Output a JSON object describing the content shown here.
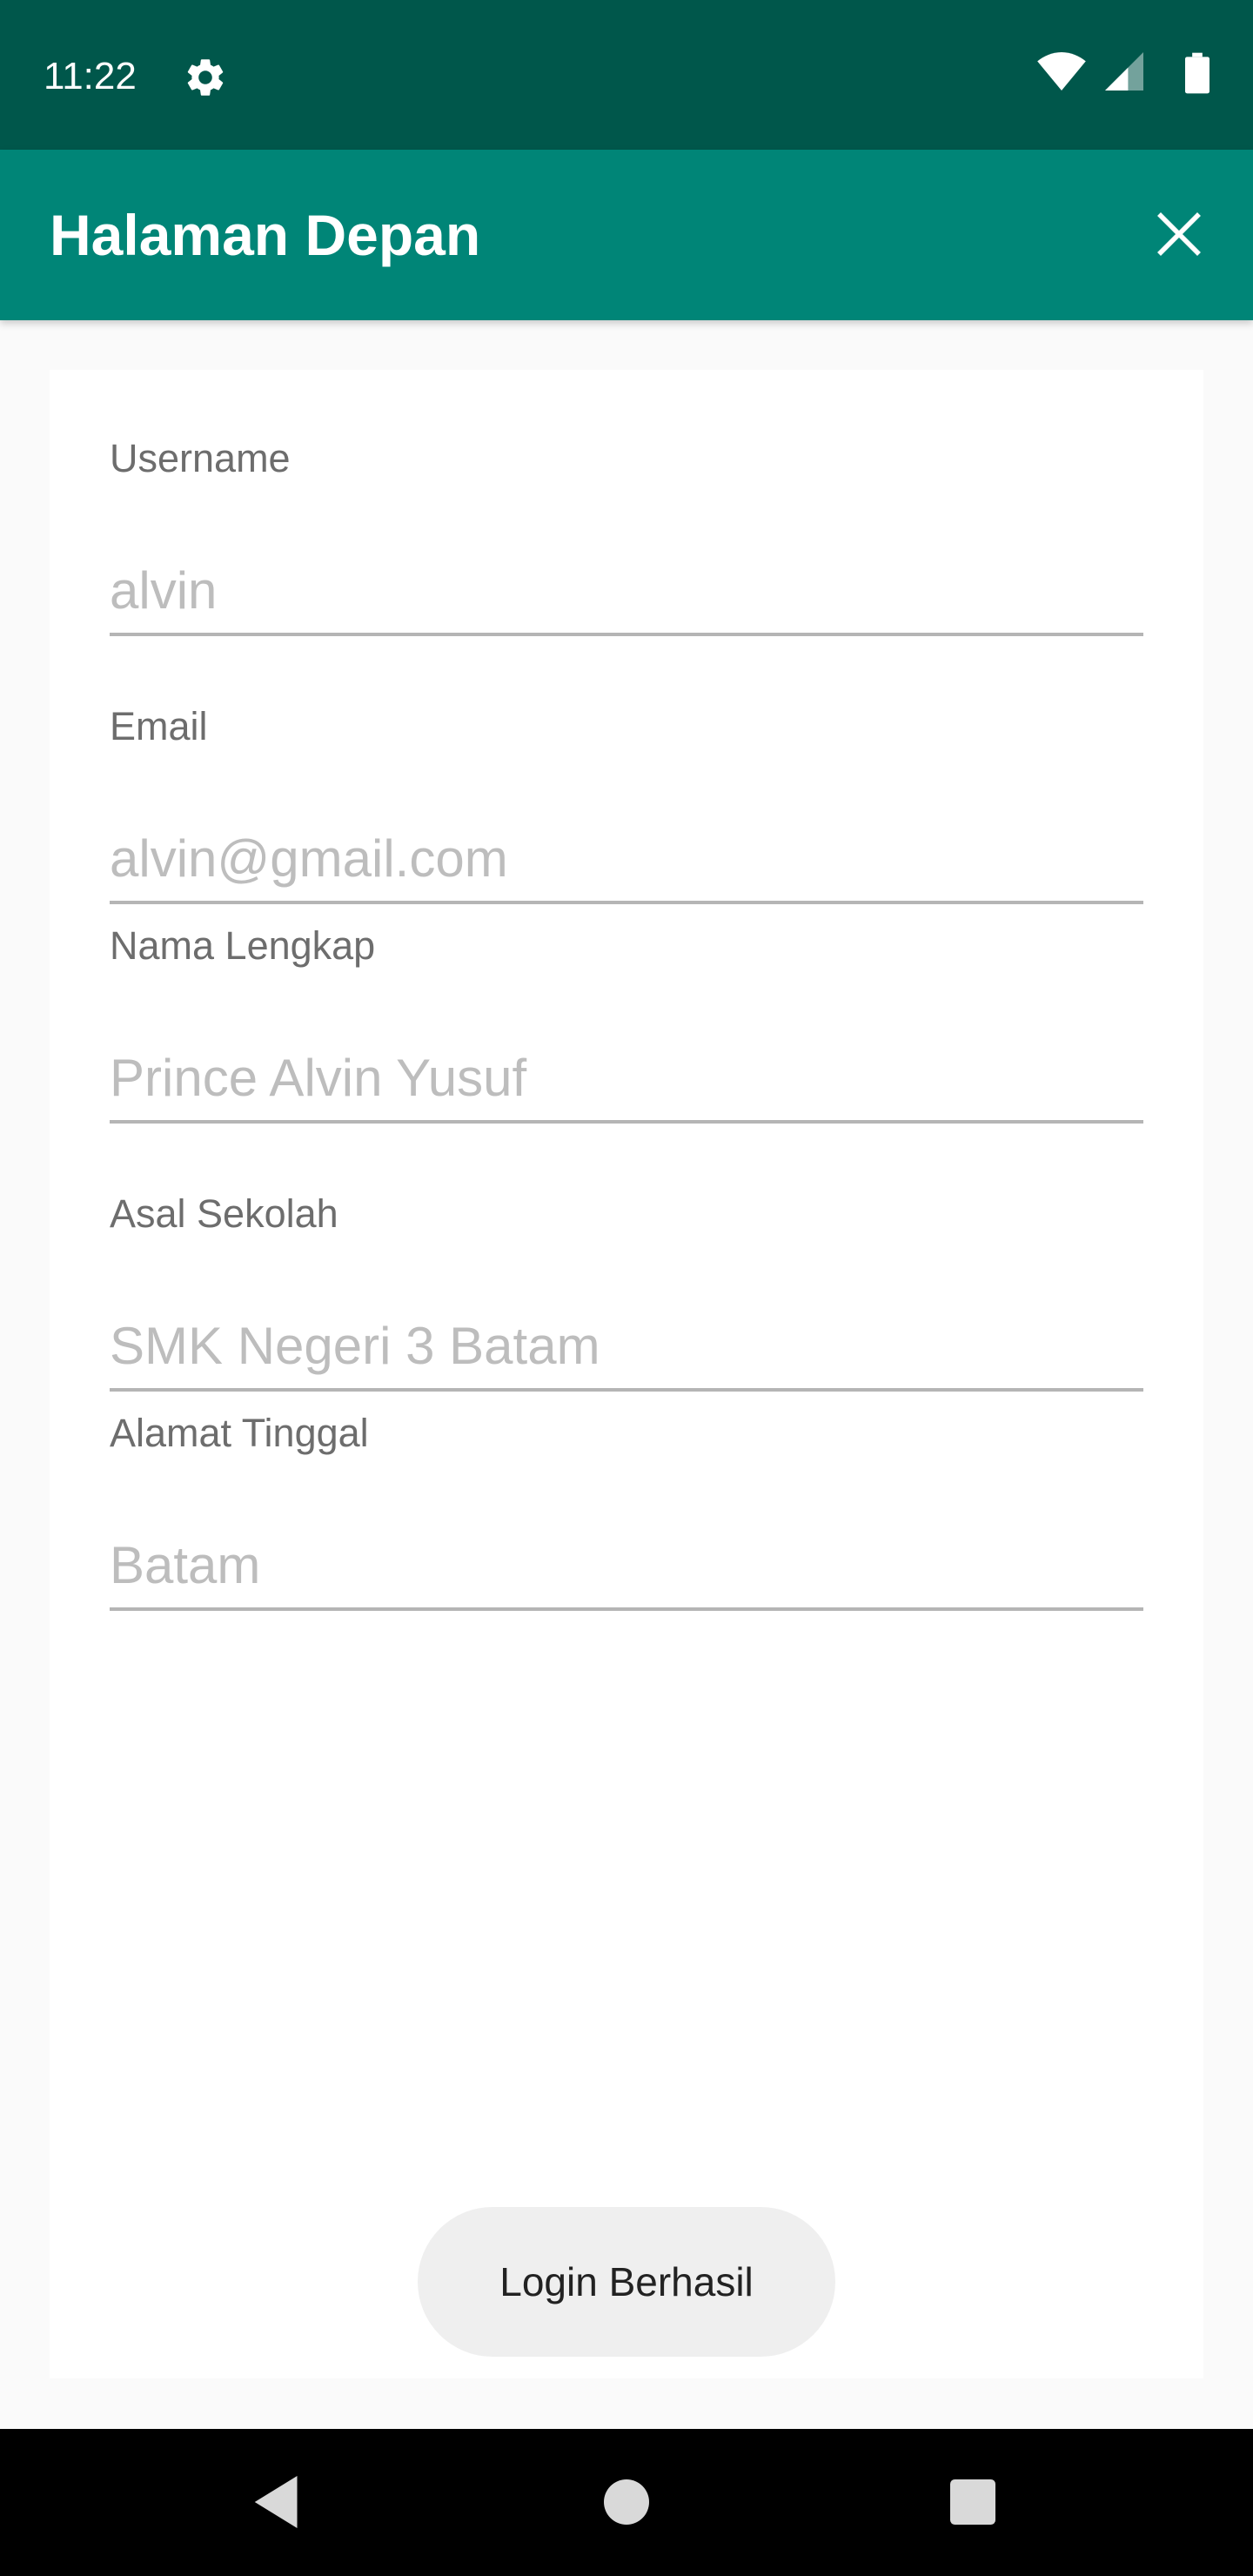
{
  "status_bar": {
    "time": "11:22",
    "icons": [
      "settings-icon",
      "wifi-icon",
      "signal-icon",
      "battery-icon"
    ],
    "background": "#00574b"
  },
  "app_bar": {
    "title": "Halaman Depan",
    "close_icon": "close-icon",
    "background": "#008577"
  },
  "form": {
    "fields": [
      {
        "label": "Username",
        "placeholder": "alvin"
      },
      {
        "label": "Email",
        "placeholder": "alvin@gmail.com"
      },
      {
        "label": "Nama Lengkap",
        "placeholder": "Prince Alvin Yusuf"
      },
      {
        "label": "Asal Sekolah",
        "placeholder": "SMK Negeri 3 Batam"
      },
      {
        "label": "Alamat Tinggal",
        "placeholder": "Batam"
      }
    ]
  },
  "toast": {
    "text": "Login Berhasil"
  },
  "nav_bar": {
    "icons": [
      "back-icon",
      "home-icon",
      "recents-icon"
    ]
  }
}
